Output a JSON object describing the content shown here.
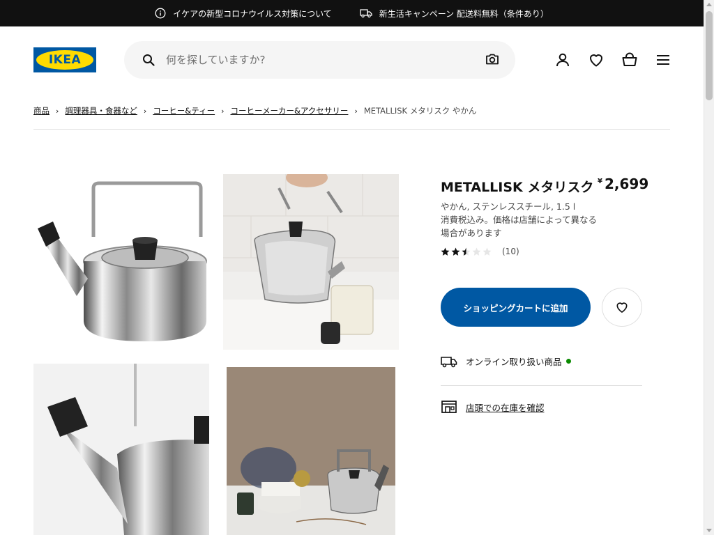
{
  "topbar": {
    "notice_1": "イケアの新型コロナウイルス対策について",
    "notice_2": "新生活キャンペーン 配送料無料（条件あり）"
  },
  "header": {
    "logo_text": "IKEA",
    "search_placeholder": "何を探していますか?"
  },
  "breadcrumb": [
    "商品",
    "調理器具・食器など",
    "コーヒー&ティー",
    "コーヒーメーカー&アクセサリー",
    "METALLISK メタリスク やかん"
  ],
  "product": {
    "name": "METALLISK メタリスク",
    "price_currency": "¥",
    "price_amount": "2,699",
    "description_line_1": "やかん, ステンレススチール, 1.5 l",
    "description_line_2": "消費税込み。価格は店舗によって異なる場合があります",
    "rating_value": 2.5,
    "rating_max": 5,
    "review_count": "(10)",
    "add_to_cart_label": "ショッピングカートに追加",
    "online_label": "オンライン取り扱い商品",
    "online_status_color": "#0a8a00",
    "store_stock_label": "店頭での在庫を確認"
  },
  "colors": {
    "brand_blue": "#0058a3",
    "brand_yellow": "#ffdb00",
    "topbar_bg": "#111111"
  }
}
